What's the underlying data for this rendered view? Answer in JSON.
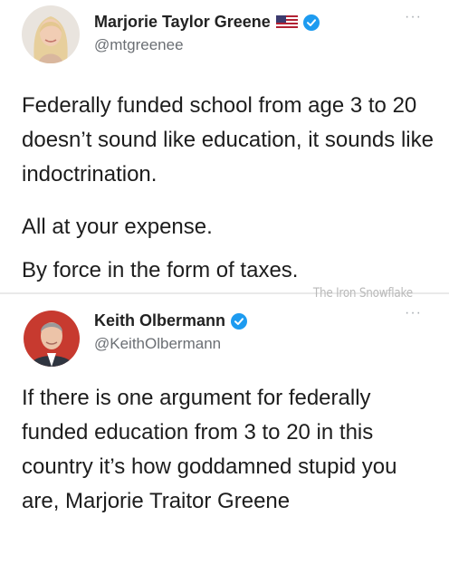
{
  "tweets": [
    {
      "name": "Marjorie Taylor Greene",
      "handle": "@mtgreenee",
      "more_icon": "···",
      "paragraphs": [
        "Federally funded school from age 3 to 20 doesn’t sound like education, it sounds like indoctrination.",
        "All at your expense.",
        "By force in the form of taxes."
      ],
      "icons": [
        "us-flag-icon",
        "verified-badge-icon",
        "more-options-icon"
      ]
    },
    {
      "name": "Keith Olbermann",
      "handle": "@KeithOlbermann",
      "more_icon": "···",
      "paragraphs": [
        "If there is one argument for federally funded education from 3 to 20 in this country it’s how goddamned stupid you are, Marjorie Traitor Greene"
      ],
      "icons": [
        "verified-badge-icon",
        "more-options-icon"
      ]
    }
  ],
  "watermark": "The Iron Snowflake",
  "colors": {
    "verified": "#1d9bf0",
    "text": "#1d1d1d",
    "handle": "#6b6f74",
    "divider": "#e9e9e9"
  }
}
